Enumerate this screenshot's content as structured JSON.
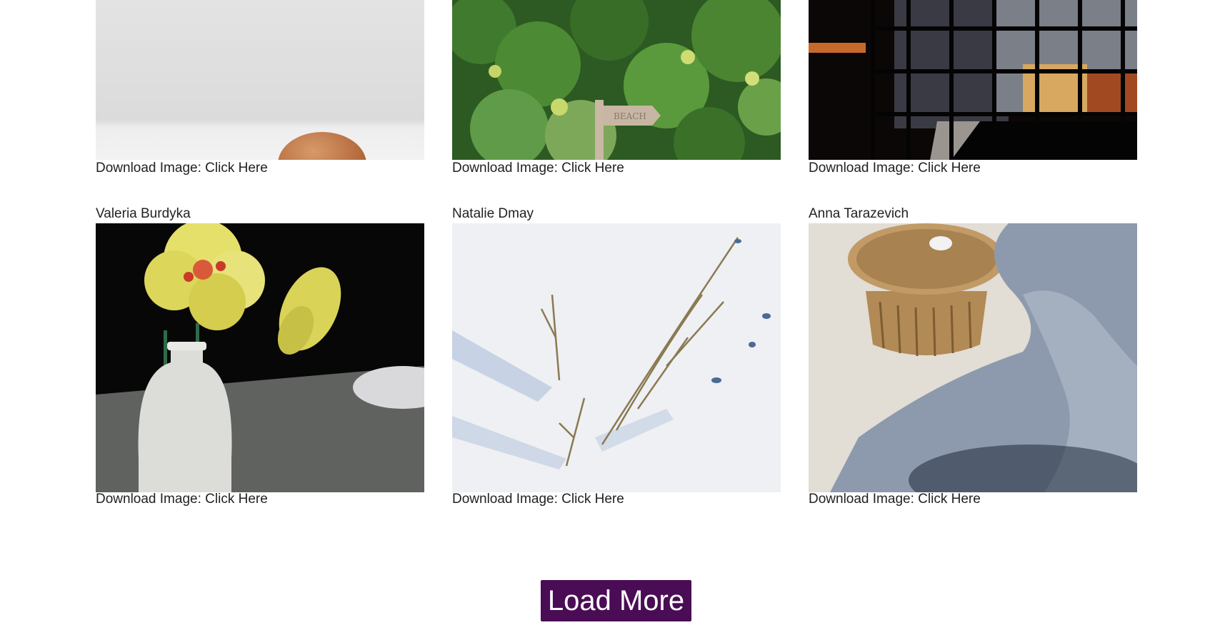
{
  "download_prefix": "Download Image:",
  "download_link_label": "Click Here",
  "rows": [
    {
      "cards": [
        {
          "author": "",
          "photo_icon": "egg-on-white-photo"
        },
        {
          "author": "",
          "photo_icon": "bush-beach-sign-photo"
        },
        {
          "author": "",
          "photo_icon": "dark-window-grid-photo"
        }
      ]
    },
    {
      "cards": [
        {
          "author": "Valeria Burdyka",
          "photo_icon": "yellow-flowers-vase-photo"
        },
        {
          "author": "Natalie Dmay",
          "photo_icon": "twigs-in-snow-photo"
        },
        {
          "author": "Anna Tarazevich",
          "photo_icon": "rattan-table-cushion-photo"
        }
      ]
    }
  ],
  "load_more_label": "Load More",
  "colors": {
    "button_bg": "#4a0c55",
    "button_text": "#ffffff",
    "text": "#222222"
  }
}
